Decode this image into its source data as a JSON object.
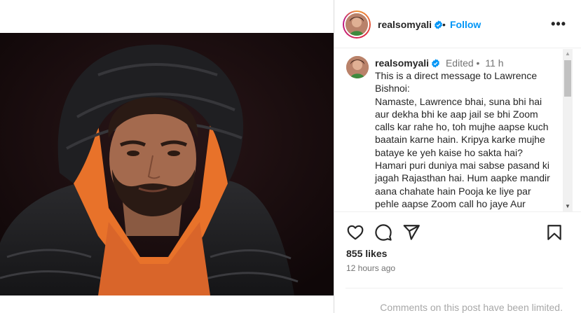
{
  "post": {
    "username": "realsomyali",
    "follow_label": "Follow",
    "header_separator": "•",
    "more_label": "•••",
    "caption": {
      "username": "realsomyali",
      "edited_label": "Edited •",
      "time": "11 h",
      "lines": [
        "This is a direct message to Lawrence Bishnoi:",
        "Namaste, Lawrence bhai, suna bhi hai aur dekha bhi ke aap jail se bhi Zoom calls kar rahe ho, toh mujhe aapse kuch baatain karne hain. Kripya karke mujhe bataye ke yeh kaise ho sakta hai? Hamari puri duniya mai sabse pasand ki jagah Rajasthan hai. Hum aapke mandir aana chahate hain Pooja ke liye par pehle aapse Zoom call ho jaye Aur"
      ]
    },
    "likes": "855 likes",
    "posted": "12 hours ago",
    "comments_limited": "Comments on this post have been limited."
  },
  "icons": {
    "verified": "verified-badge-icon",
    "like": "heart-icon",
    "comment": "comment-bubble-icon",
    "share": "paper-plane-icon",
    "save": "bookmark-icon"
  },
  "colors": {
    "follow_blue": "#0095f6",
    "verified_blue": "#0095f6",
    "muted_text": "#737373",
    "photo_background": "#150b0d",
    "jacket_orange": "#e8722a"
  }
}
